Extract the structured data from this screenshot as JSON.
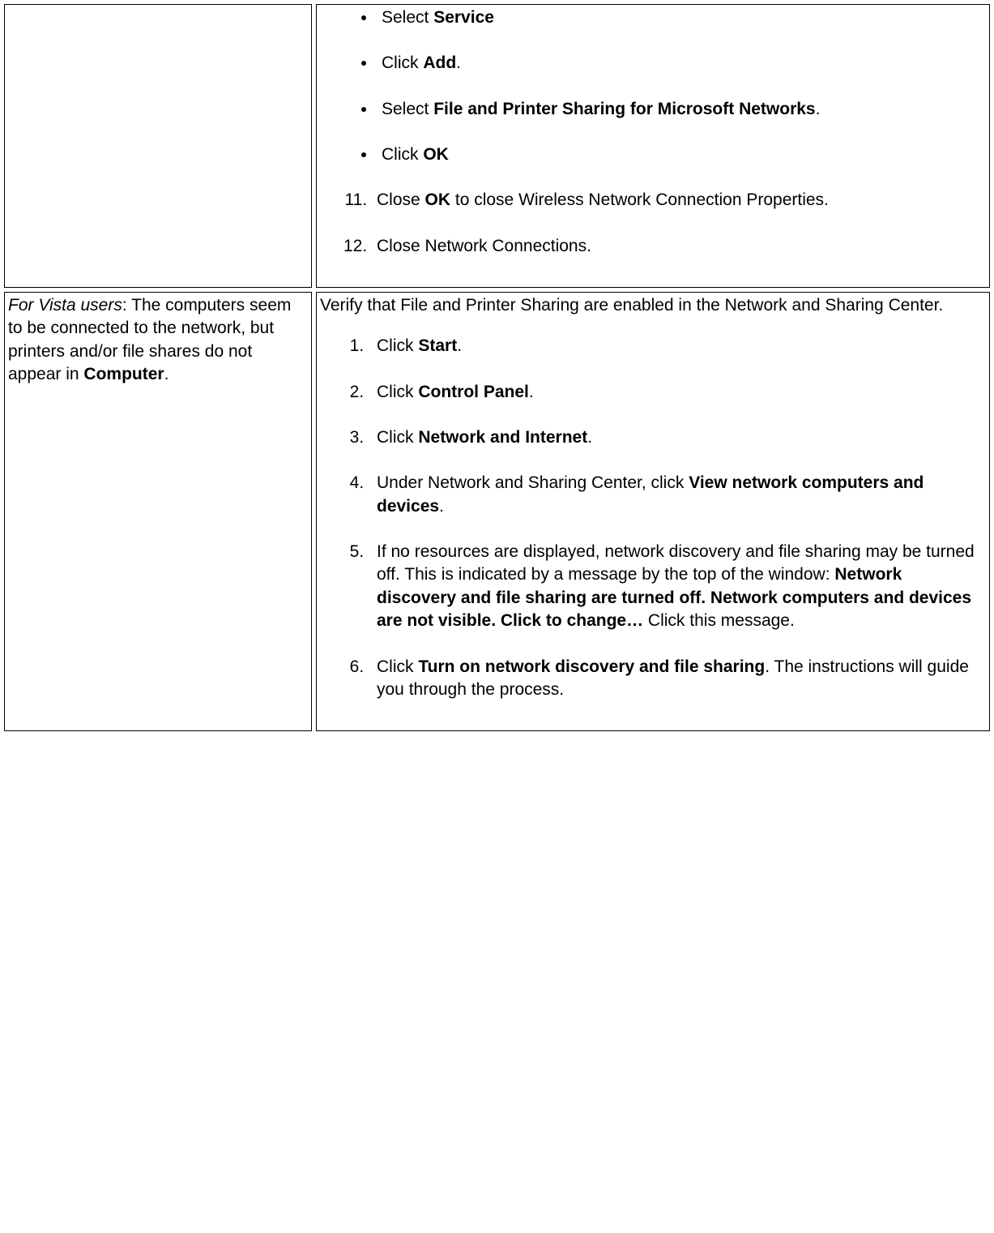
{
  "row1": {
    "left": "",
    "right": {
      "bullets": [
        {
          "pre": "Select ",
          "bold": "Service",
          "post": ""
        },
        {
          "pre": "Click ",
          "bold": "Add",
          "post": "."
        },
        {
          "pre": "Select ",
          "bold": "File and Printer Sharing for Microsoft Networks",
          "post": "."
        },
        {
          "pre": "Click ",
          "bold": "OK",
          "post": ""
        }
      ],
      "ol_start": 11,
      "ol_items": [
        {
          "pre": "Close ",
          "bold": "OK",
          "post": " to close Wireless Network Connection Properties."
        },
        {
          "text": "Close Network Connections."
        }
      ]
    }
  },
  "row2": {
    "left": {
      "i_pre": "For Vista users",
      "plain": ": The computers seem to be connected to the network, but printers and/or file shares do not appear in ",
      "bold": "Computer",
      "post": "."
    },
    "right": {
      "intro": "Verify that File and Printer Sharing are enabled in the Network and Sharing Center.",
      "ol_items": [
        {
          "pre": "Click ",
          "bold": "Start",
          "post": "."
        },
        {
          "pre": "Click ",
          "bold": "Control Panel",
          "post": "."
        },
        {
          "pre": "Click ",
          "bold": "Network and Internet",
          "post": "."
        },
        {
          "pre": "Under Network and Sharing Center, click ",
          "bold": "View network computers and devices",
          "post": "."
        },
        {
          "pre": "If no resources are displayed, network discovery and file sharing may be turned off. This is indicated by a message by the top of the window: ",
          "bold": "Network discovery and file sharing are turned off. Network computers and devices are not visible. Click to change…",
          "post": " Click this message."
        },
        {
          "pre": "Click ",
          "bold": "Turn on network discovery and file sharing",
          "post": ". The instructions will guide you through the process."
        }
      ]
    }
  }
}
